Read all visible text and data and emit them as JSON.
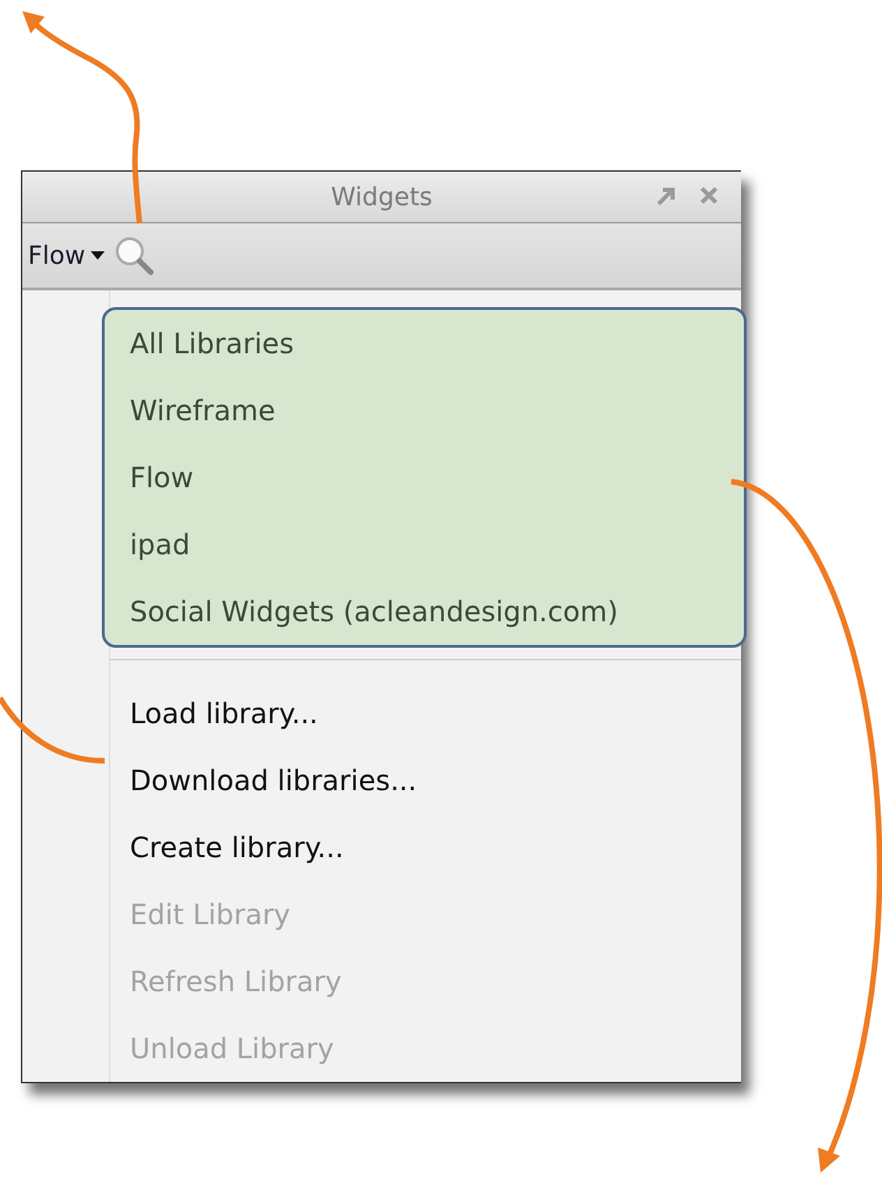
{
  "panel": {
    "title": "Widgets",
    "library_dropdown": "Flow"
  },
  "menu": {
    "libraries": [
      {
        "label": "All Libraries"
      },
      {
        "label": "Wireframe"
      },
      {
        "label": "Flow"
      },
      {
        "label": "ipad"
      },
      {
        "label": "Social Widgets (acleandesign.com)"
      }
    ],
    "actions": [
      {
        "label": "Load library...",
        "disabled": false
      },
      {
        "label": "Download libraries...",
        "disabled": false
      },
      {
        "label": "Create library...",
        "disabled": false
      },
      {
        "label": "Edit Library",
        "disabled": true
      },
      {
        "label": "Refresh Library",
        "disabled": true
      },
      {
        "label": "Unload Library",
        "disabled": true
      }
    ]
  }
}
